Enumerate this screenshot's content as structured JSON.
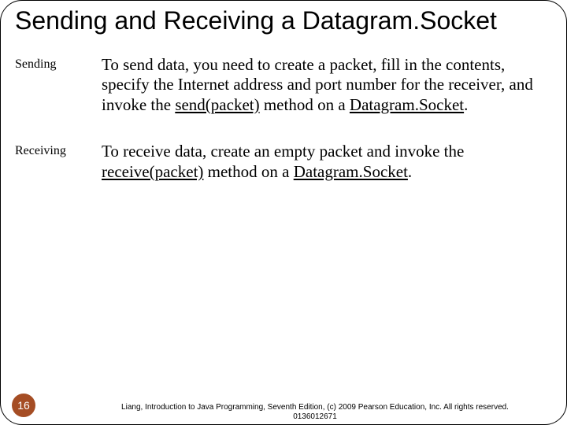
{
  "title": "Sending and Receiving a Datagram.Socket",
  "rows": [
    {
      "label": "Sending",
      "pre": "To send data, you need to create a packet, fill in the contents, specify the Internet address and port number for the receiver, and invoke the ",
      "u1": "send(packet)",
      "mid": " method on a ",
      "u2": "Datagram.Socket",
      "post": "."
    },
    {
      "label": "Receiving",
      "pre": "To receive data, create an empty packet and invoke the ",
      "u1": "receive(packet)",
      "mid": " method on a ",
      "u2": "Datagram.Socket",
      "post": "."
    }
  ],
  "page_number": "16",
  "footer": "Liang, Introduction to Java Programming, Seventh Edition, (c) 2009 Pearson Education, Inc. All rights reserved. 0136012671"
}
